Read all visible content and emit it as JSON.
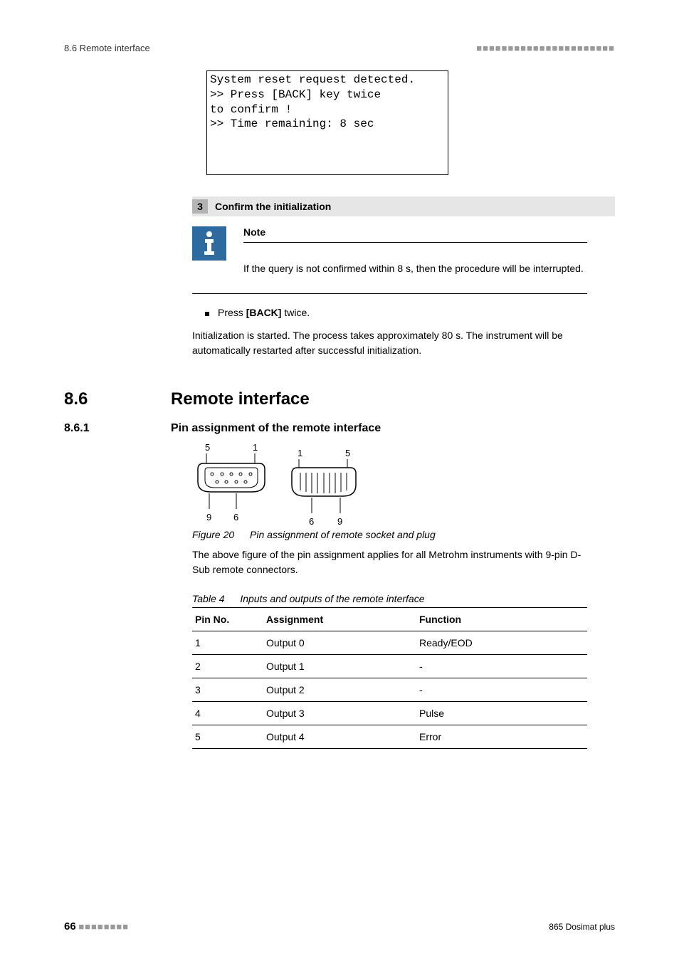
{
  "header": {
    "left": "8.6 Remote interface"
  },
  "lcd": {
    "line1": "System reset request detected.",
    "line2": ">> Press [BACK] key twice",
    "line3": "   to confirm !",
    "line4": ">> Time remaining: 8 sec"
  },
  "step": {
    "number": "3",
    "title": "Confirm the initialization",
    "note_label": "Note",
    "note_text": "If the query is not confirmed within 8 s, then the procedure will be interrupted.",
    "bullet_pre": "Press ",
    "bullet_key": "[BACK]",
    "bullet_post": " twice.",
    "result": "Initialization is started. The process takes approximately 80 s. The instrument will be automatically restarted after successful initialization."
  },
  "section": {
    "num": "8.6",
    "title": "Remote interface"
  },
  "subsection": {
    "num": "8.6.1",
    "title": "Pin assignment of the remote interface"
  },
  "figure": {
    "label": "Figure 20",
    "caption": "Pin assignment of remote socket and plug",
    "para": "The above figure of the pin assignment applies for all Metrohm instruments with 9-pin D-Sub remote connectors.",
    "socket_labels": {
      "tl": "5",
      "tr": "1",
      "bl": "9",
      "br": "6"
    },
    "plug_labels": {
      "tl": "1",
      "tr": "5",
      "bl": "6",
      "br": "9"
    }
  },
  "table": {
    "label": "Table 4",
    "caption": "Inputs and outputs of the remote interface",
    "headers": [
      "Pin No.",
      "Assignment",
      "Function"
    ],
    "rows": [
      {
        "c0": "1",
        "c1": "Output 0",
        "c2": "Ready/EOD"
      },
      {
        "c0": "2",
        "c1": "Output 1",
        "c2": "-"
      },
      {
        "c0": "3",
        "c1": "Output 2",
        "c2": "-"
      },
      {
        "c0": "4",
        "c1": "Output 3",
        "c2": "Pulse"
      },
      {
        "c0": "5",
        "c1": "Output 4",
        "c2": "Error"
      }
    ]
  },
  "footer": {
    "page": "66",
    "doc": "865 Dosimat plus"
  }
}
